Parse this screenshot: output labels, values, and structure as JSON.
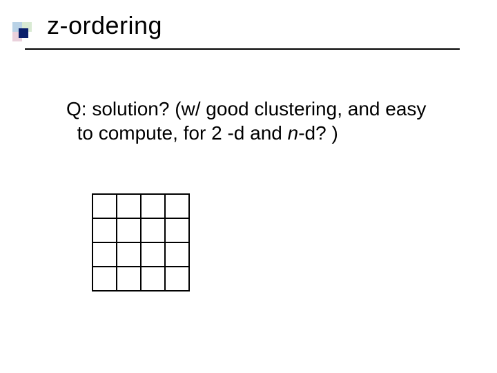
{
  "title": "z-ordering",
  "body": {
    "line1": "Q: solution? (w/ good clustering, and easy",
    "line2_a": "to compute, for 2 -d and ",
    "line2_italic": "n",
    "line2_b": "-d? )"
  },
  "grid": {
    "rows": 4,
    "cols": 4
  }
}
